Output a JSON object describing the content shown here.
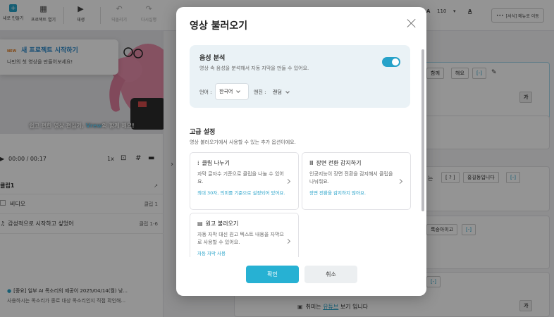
{
  "toolbar": {
    "new_project": "새로 만들기",
    "open_project": "프로젝트 열기",
    "play": "재생",
    "undo": "되돌리기",
    "redo": "다시실행",
    "font_size": "110",
    "format_menu": "[서식] 메뉴로 이동"
  },
  "promo": {
    "badge": "NEW",
    "title": "새 프로젝트 시작하기",
    "subtitle": "나만의 첫 영상을 만들어보세요!"
  },
  "video": {
    "caption_prefix": "쉽고 편한 영상 편집기, ",
    "caption_brand": "Vrew",
    "caption_suffix": "와 함께 해요!"
  },
  "player": {
    "time": "00:00 / 00:17",
    "speed": "1x"
  },
  "clips": {
    "header": "클립1",
    "rows": [
      {
        "label": "비디오",
        "right": "클립 1"
      },
      {
        "label": "감성적으로 시작하고 싶었어",
        "right": "클립 1-6"
      }
    ]
  },
  "notice": {
    "line1": "[중요] 일부 AI 목소리의 제공이 2025/04/14(월) 낮...",
    "line2": "사용하시는 목소리가 종료 대상 목소리인지 직접 확인해..."
  },
  "editor": {
    "chip_together": "함께",
    "chip_do": "해요",
    "chip_bracket": "[-]",
    "chip_ga": "가",
    "chip_is": "는",
    "chip_q": "[ ? ]",
    "chip_name": "홍길동입니다",
    "chip_feel": "록숭아이고",
    "youtube_prefix": "취미는 ",
    "youtube_link": "유튜브",
    "youtube_suffix": " 보기 입니다"
  },
  "modal": {
    "title": "영상 불러오기",
    "stt": {
      "title": "음성 분석",
      "description": "영상 속 음성을 분석해서 자동 자막을 만들 수 있어요.",
      "toggle_on": true,
      "language_label": "언어 :",
      "language_value": "한국어",
      "engine_label": "엔진 :",
      "engine_value": "랜덤"
    },
    "advanced": {
      "title": "고급 설정",
      "description": "영상 불러오기에서 사용할 수 있는 추가 옵션이에요."
    },
    "options": [
      {
        "title": "클립 나누기",
        "description": "자막 글자수 기준으로 클립을 나눌 수 있어요.",
        "note": "최대 30자, 의미를 기준으로 설정되어 있어요."
      },
      {
        "title": "장면 전환 감지하기",
        "description": "인공지능이 장면 전환을 감지해서 클립을 나눠줘요.",
        "note": "장면 전환을 감지하지 않아요."
      },
      {
        "title": "원고 불러오기",
        "description": "자동 자막 대신 원고 텍스트 내용을 자막으로 사용할 수 있어요.",
        "note": "자동 자막 사용"
      }
    ],
    "ok_label": "확인",
    "cancel_label": "취소"
  }
}
